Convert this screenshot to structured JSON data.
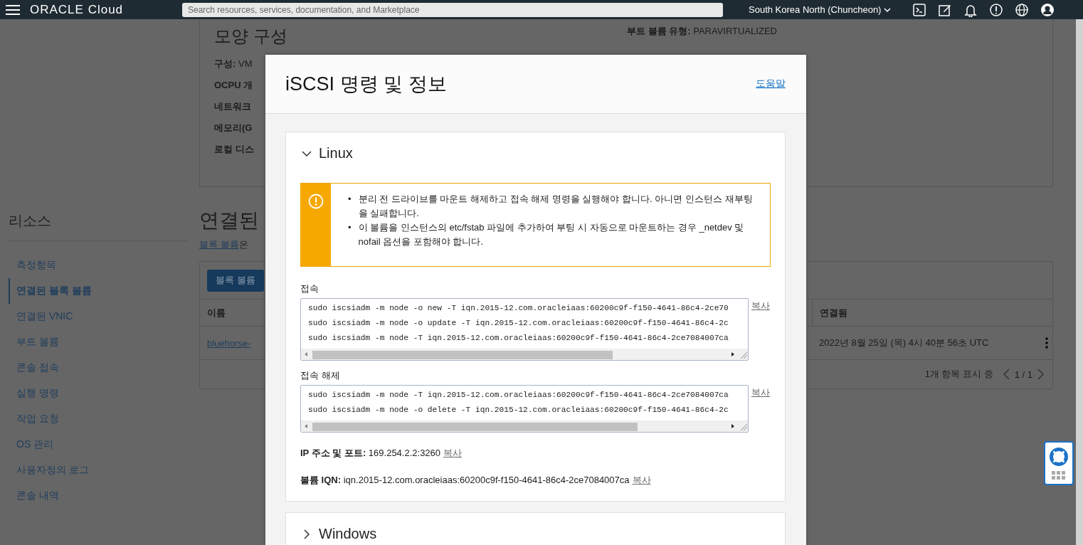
{
  "header": {
    "logo": "ORACLE Cloud",
    "search": {
      "placeholder": "Search resources, services, documentation, and Marketplace"
    },
    "region": "South Korea North (Chuncheon)"
  },
  "shape_card": {
    "title": "모양 구성",
    "left_rows": [
      {
        "label": "구성:",
        "value": "VM"
      },
      {
        "label": "OCPU 개",
        "value": ""
      },
      {
        "label": "네트워크",
        "value": ""
      },
      {
        "label": "메모리(G",
        "value": ""
      },
      {
        "label": "로컬 디스",
        "value": ""
      }
    ],
    "right_rows": [
      {
        "label": "부트 볼륨 유형:",
        "value": "PARAVIRTUALIZED"
      }
    ]
  },
  "sidebar": {
    "title": "리소스",
    "items": [
      {
        "label": "측정항목",
        "selected": false
      },
      {
        "label": "연결된 블록 볼륨",
        "selected": true
      },
      {
        "label": "연결된 VNIC",
        "selected": false
      },
      {
        "label": "부트 볼륨",
        "selected": false
      },
      {
        "label": "콘솔 접속",
        "selected": false
      },
      {
        "label": "실행 명령",
        "selected": false
      },
      {
        "label": "작업 요청",
        "selected": false
      },
      {
        "label": "OS 관리",
        "selected": false
      },
      {
        "label": "사용자정의 로그",
        "selected": false
      },
      {
        "label": "콘솔 내역",
        "selected": false
      }
    ]
  },
  "volumes": {
    "title": "연결된",
    "intro_link": "블록 볼륨",
    "intro_text": "은",
    "button": "블록 볼륨",
    "table": {
      "columns": [
        "이름",
        "연결됨"
      ],
      "rows": [
        {
          "name": "bluehorse-",
          "attached": "2022년 8월 25일 (목) 4시 40분 56초 UTC"
        }
      ]
    },
    "footer": {
      "count": "1개 항목 표시 중",
      "page": "1 / 1"
    }
  },
  "dialog": {
    "title": "iSCSI 명령 및 정보",
    "help_link": "도움말",
    "sections": [
      {
        "title": "Linux",
        "expanded": true,
        "warnings": [
          {
            "bullet": "•",
            "text": "분리 전 드라이브를 마운트 해제하고 접속 해제 명령을 실행해야 합니다. 아니면 인스턴스 재부팅을 실패합니다."
          },
          {
            "bullet": "•",
            "text": "이 볼륨을 인스턴스의 etc/fstab 파일에 추가하여 부팅 시 자동으로 마운트하는 경우 _netdev 및 nofail 옵션을 포함해야 합니다."
          }
        ],
        "commands": [
          {
            "label": "접속",
            "copy": "복사",
            "lines": [
              "sudo iscsiadm -m node -o new -T iqn.2015-12.com.oracleiaas:60200c9f-f150-4641-86c4-2ce70",
              "sudo iscsiadm -m node -o update -T iqn.2015-12.com.oracleiaas:60200c9f-f150-4641-86c4-2c",
              "sudo iscsiadm -m node -T iqn.2015-12.com.oracleiaas:60200c9f-f150-4641-86c4-2ce7084007ca"
            ]
          },
          {
            "label": "접속 해제",
            "copy": "복사",
            "lines": [
              "sudo iscsiadm -m node -T iqn.2015-12.com.oracleiaas:60200c9f-f150-4641-86c4-2ce7084007ca",
              "sudo iscsiadm -m node -o delete -T iqn.2015-12.com.oracleiaas:60200c9f-f150-4641-86c4-2c"
            ]
          }
        ],
        "details": [
          {
            "label": "IP 주소 및 포트:",
            "value": "169.254.2.2:3260",
            "copy": "복사"
          },
          {
            "label": "볼륨 IQN:",
            "value": "iqn.2015-12.com.oracleiaas:60200c9f-f150-4641-86c4-2ce7084007ca",
            "copy": "복사"
          }
        ]
      },
      {
        "title": "Windows",
        "expanded": false
      }
    ]
  }
}
